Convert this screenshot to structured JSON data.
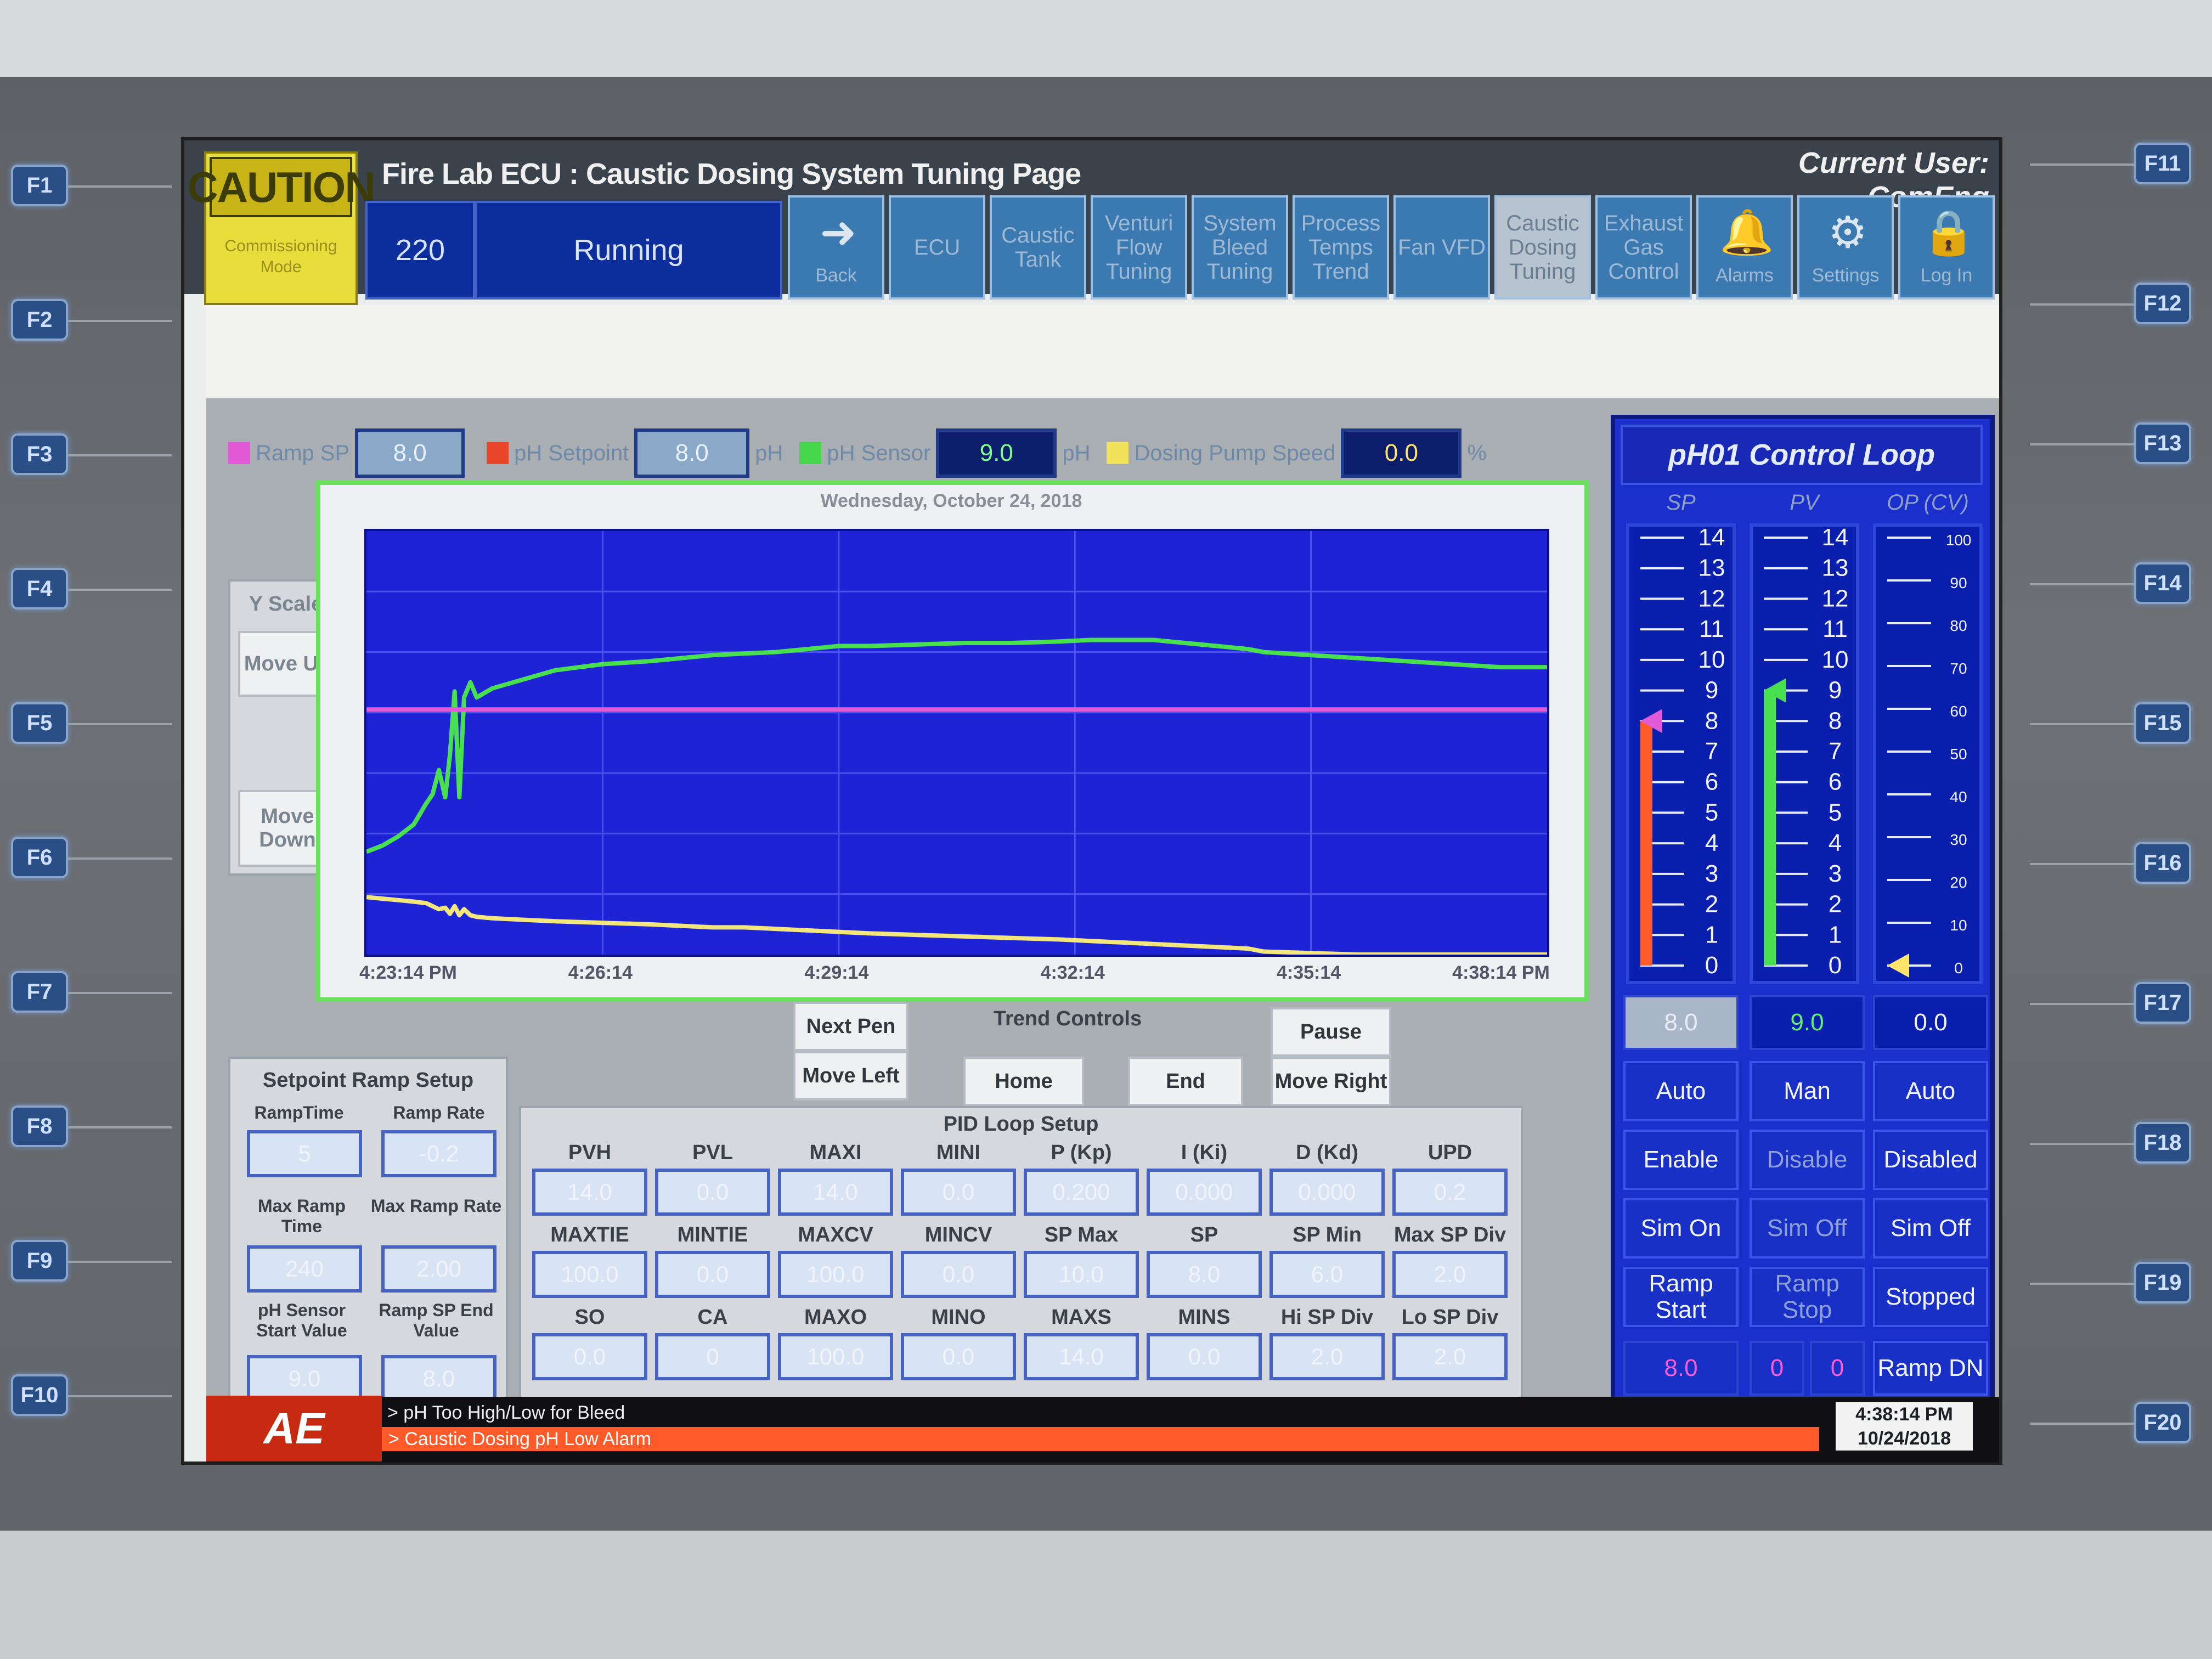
{
  "header": {
    "caution_label": "CAUTION",
    "caution_sub": "Commissioning Mode",
    "app_title": "Fire Lab ECU : Caustic Dosing System Tuning Page",
    "current_user": "Current User: ComEng",
    "status_code": "220",
    "status_text": "Running"
  },
  "nav": [
    {
      "label": "Back",
      "icon": "back-arrow-icon"
    },
    {
      "label": "ECU"
    },
    {
      "label": "Caustic Tank"
    },
    {
      "label": "Venturi Flow Tuning"
    },
    {
      "label": "System Bleed Tuning"
    },
    {
      "label": "Process Temps Trend"
    },
    {
      "label": "Fan VFD"
    },
    {
      "label": "Caustic Dosing Tuning"
    },
    {
      "label": "Exhaust Gas Control"
    },
    {
      "label": "Alarms",
      "icon": "bell-icon"
    },
    {
      "label": "Settings",
      "icon": "gear-icon"
    },
    {
      "label": "Log In",
      "icon": "lock-icon"
    }
  ],
  "fkeys_left": [
    "F1",
    "F2",
    "F3",
    "F4",
    "F5",
    "F6",
    "F7",
    "F8",
    "F9",
    "F10"
  ],
  "fkeys_right": [
    "F11",
    "F12",
    "F13",
    "F14",
    "F15",
    "F16",
    "F17",
    "F18",
    "F19",
    "F20"
  ],
  "legend": {
    "ramp_sp_label": "Ramp SP",
    "ramp_sp_value": "8.0",
    "ph_setpoint_label": "pH Setpoint",
    "ph_setpoint_value": "8.0",
    "unit_ph": "pH",
    "ph_sensor_label": "pH Sensor",
    "ph_sensor_value": "9.0",
    "pump_speed_label": "Dosing Pump Speed",
    "pump_speed_value": "0.0",
    "unit_pct": "%",
    "colors": {
      "ramp_sp": "#e25ad6",
      "ph_setpoint": "#e8452a",
      "ph_sensor": "#45d64a",
      "pump": "#f1e05a"
    }
  },
  "yscale": {
    "title": "Y Scale",
    "move_up": "Move Up",
    "move_down": "Move Down"
  },
  "chart_data": {
    "type": "line",
    "title": "Wednesday, October 24, 2018",
    "x_ticks": [
      "4:23:14 PM",
      "4:26:14",
      "4:29:14",
      "4:32:14",
      "4:35:14",
      "4:38:14 PM"
    ],
    "x": [
      0,
      1,
      2,
      3,
      3.8,
      4.2,
      4.6,
      5.0,
      5.3,
      5.6,
      5.9,
      6.2,
      6.6,
      7.0,
      8,
      10,
      12,
      15,
      18,
      20,
      22,
      24,
      26,
      28,
      30,
      32,
      35,
      38,
      41,
      44,
      46,
      48,
      50,
      52,
      54,
      56,
      57,
      60,
      63,
      66,
      69,
      72,
      75
    ],
    "xlim": [
      0,
      75
    ],
    "ylim": [
      0,
      14
    ],
    "series": [
      {
        "name": "pH Sensor",
        "color": "#49e04f",
        "values": [
          3.4,
          3.6,
          3.9,
          4.3,
          5.0,
          5.3,
          6.1,
          5.2,
          6.6,
          8.7,
          5.2,
          8.5,
          9.0,
          8.5,
          8.8,
          9.1,
          9.4,
          9.6,
          9.7,
          9.8,
          9.9,
          9.95,
          10.0,
          10.1,
          10.2,
          10.2,
          10.25,
          10.3,
          10.3,
          10.35,
          10.4,
          10.4,
          10.4,
          10.3,
          10.2,
          10.1,
          10.0,
          9.9,
          9.8,
          9.7,
          9.6,
          9.5,
          9.5
        ]
      },
      {
        "name": "Ramp SP",
        "color": "#e25ad6",
        "values": [
          8.1,
          8.1,
          8.1,
          8.1,
          8.1,
          8.1,
          8.1,
          8.1,
          8.1,
          8.1,
          8.1,
          8.1,
          8.1,
          8.1,
          8.1,
          8.1,
          8.1,
          8.1,
          8.1,
          8.1,
          8.1,
          8.1,
          8.1,
          8.1,
          8.1,
          8.1,
          8.1,
          8.1,
          8.1,
          8.1,
          8.1,
          8.1,
          8.1,
          8.1,
          8.1,
          8.1,
          8.1,
          8.1,
          8.1,
          8.1,
          8.1,
          8.1,
          8.1
        ]
      },
      {
        "name": "Dosing Pump Speed",
        "color": "#f3e67a",
        "values": [
          1.9,
          1.85,
          1.8,
          1.75,
          1.7,
          1.6,
          1.5,
          1.55,
          1.35,
          1.6,
          1.3,
          1.5,
          1.3,
          1.25,
          1.2,
          1.15,
          1.1,
          1.05,
          1.0,
          0.95,
          0.9,
          0.9,
          0.85,
          0.8,
          0.75,
          0.7,
          0.65,
          0.6,
          0.55,
          0.5,
          0.45,
          0.4,
          0.35,
          0.3,
          0.25,
          0.2,
          0.1,
          0.05,
          0.0,
          0.0,
          0.0,
          0.0,
          0.0
        ]
      }
    ]
  },
  "trend_controls": {
    "title": "Trend Controls",
    "next_pen": "Next Pen",
    "move_left": "Move Left",
    "home": "Home",
    "end": "End",
    "pause": "Pause",
    "move_right": "Move Right"
  },
  "ramp_setup": {
    "title": "Setpoint Ramp Setup",
    "ramp_time_label": "RampTime",
    "ramp_time": "5",
    "ramp_rate_label": "Ramp Rate",
    "ramp_rate": "-0.2",
    "max_ramp_time_label": "Max Ramp Time",
    "max_ramp_time": "240",
    "max_ramp_rate_label": "Max Ramp Rate",
    "max_ramp_rate": "2.00",
    "ph_start_label": "pH Sensor Start Value",
    "ph_start": "9.0",
    "ramp_end_label": "Ramp SP End Value",
    "ramp_end": "8.0"
  },
  "pid": {
    "title": "PID Loop Setup",
    "rows": [
      [
        {
          "label": "PVH",
          "value": "14.0"
        },
        {
          "label": "PVL",
          "value": "0.0"
        },
        {
          "label": "MAXI",
          "value": "14.0"
        },
        {
          "label": "MINI",
          "value": "0.0"
        },
        {
          "label": "P (Kp)",
          "value": "0.200"
        },
        {
          "label": "I (Ki)",
          "value": "0.000"
        },
        {
          "label": "D (Kd)",
          "value": "0.000"
        },
        {
          "label": "UPD",
          "value": "0.2"
        }
      ],
      [
        {
          "label": "MAXTIE",
          "value": "100.0"
        },
        {
          "label": "MINTIE",
          "value": "0.0"
        },
        {
          "label": "MAXCV",
          "value": "100.0"
        },
        {
          "label": "MINCV",
          "value": "0.0"
        },
        {
          "label": "SP Max",
          "value": "10.0"
        },
        {
          "label": "SP",
          "value": "8.0"
        },
        {
          "label": "SP Min",
          "value": "6.0"
        },
        {
          "label": "Max SP Div",
          "value": "2.0"
        }
      ],
      [
        {
          "label": "SO",
          "value": "0.0"
        },
        {
          "label": "CA",
          "value": "0"
        },
        {
          "label": "MAXO",
          "value": "100.0"
        },
        {
          "label": "MINO",
          "value": "0.0"
        },
        {
          "label": "MAXS",
          "value": "14.0"
        },
        {
          "label": "MINS",
          "value": "0.0"
        },
        {
          "label": "Hi SP Div",
          "value": "2.0"
        },
        {
          "label": "Lo SP Div",
          "value": "2.0"
        }
      ]
    ]
  },
  "control_loop": {
    "title": "pH01 Control Loop",
    "col_sp": "SP",
    "col_pv": "PV",
    "col_op": "OP (CV)",
    "ph_scale": [
      "14",
      "13",
      "12",
      "11",
      "10",
      "9",
      "8",
      "7",
      "6",
      "5",
      "4",
      "3",
      "2",
      "1",
      "0"
    ],
    "pct_scale": [
      "100",
      "90",
      "80",
      "70",
      "60",
      "50",
      "40",
      "30",
      "20",
      "10",
      "0"
    ],
    "sp_level": 8.0,
    "pv_level": 9.0,
    "op_level": 0.0,
    "sp_value": "8.0",
    "pv_value": "9.0",
    "op_value": "0.0",
    "buttons": [
      [
        "Auto",
        "Man",
        "Auto"
      ],
      [
        "Enable",
        "Disable",
        "Disabled"
      ],
      [
        "Sim On",
        "Sim Off",
        "Sim Off"
      ],
      [
        "Ramp Start",
        "Ramp Stop",
        "Stopped"
      ]
    ],
    "bottom": {
      "sp": "8.0",
      "a": "0",
      "b": "0",
      "status": "Ramp DN"
    }
  },
  "alarms": [
    "> pH Too High/Low for Bleed",
    "> Caustic Dosing pH Low Alarm"
  ],
  "logo": "AE",
  "clock": {
    "time": "4:38:14 PM",
    "date": "10/24/2018"
  }
}
